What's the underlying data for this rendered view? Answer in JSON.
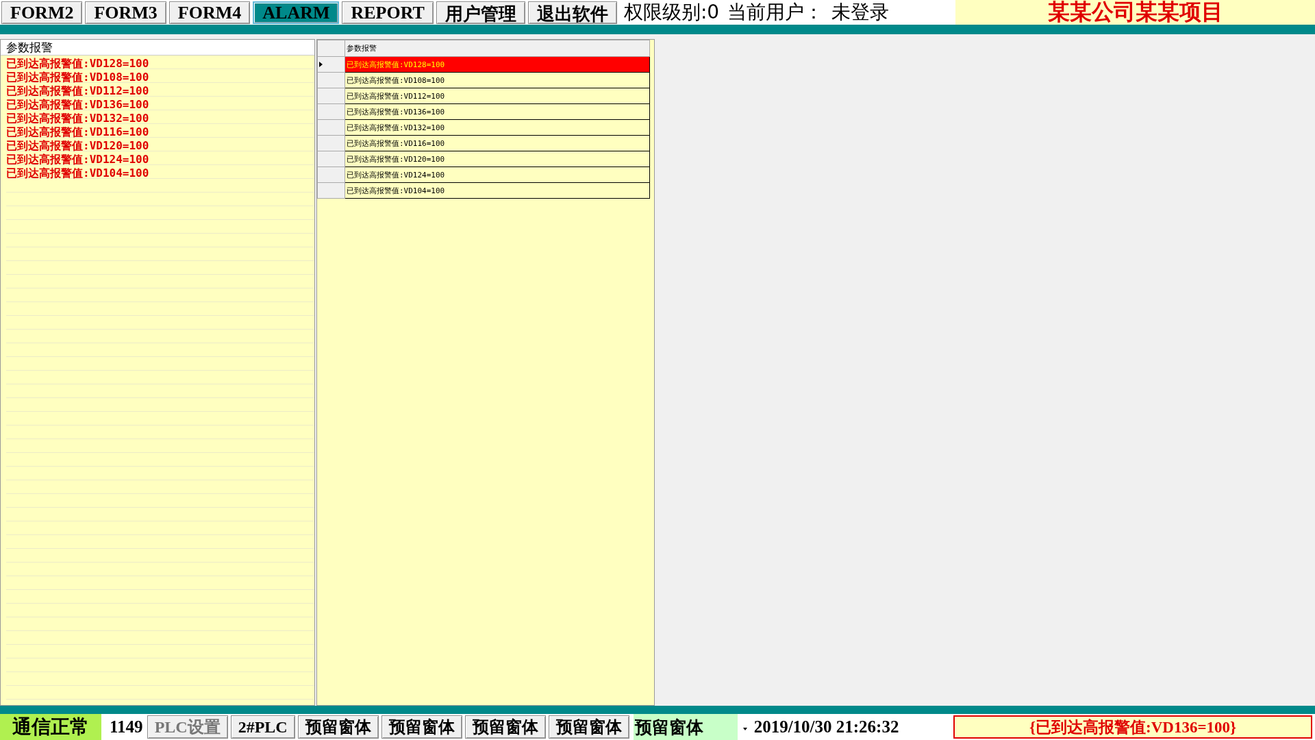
{
  "top_buttons": [
    {
      "label": "FORM2",
      "selected": false
    },
    {
      "label": "FORM3",
      "selected": false
    },
    {
      "label": "FORM4",
      "selected": false
    },
    {
      "label": "ALARM",
      "selected": true
    },
    {
      "label": "REPORT",
      "selected": false
    },
    {
      "label": "用户管理",
      "selected": false
    },
    {
      "label": "退出软件",
      "selected": false
    }
  ],
  "user_info": [
    "权限级别:0",
    "当前用户：",
    "未登录"
  ],
  "project_title": "某某公司某某项目",
  "alarm_list": {
    "header": "参数报警",
    "items": [
      "已到达高报警值:VD128=100",
      "已到达高报警值:VD108=100",
      "已到达高报警值:VD112=100",
      "已到达高报警值:VD136=100",
      "已到达高报警值:VD132=100",
      "已到达高报警值:VD116=100",
      "已到达高报警值:VD120=100",
      "已到达高报警值:VD124=100",
      "已到达高报警值:VD104=100"
    ]
  },
  "alarm_grid": {
    "column": "参数报警",
    "rows": [
      {
        "text": "已到达高报警值:VD128=100",
        "selected": true
      },
      {
        "text": "已到达高报警值:VD108=100",
        "selected": false
      },
      {
        "text": "已到达高报警值:VD112=100",
        "selected": false
      },
      {
        "text": "已到达高报警值:VD136=100",
        "selected": false
      },
      {
        "text": "已到达高报警值:VD132=100",
        "selected": false
      },
      {
        "text": "已到达高报警值:VD116=100",
        "selected": false
      },
      {
        "text": "已到达高报警值:VD120=100",
        "selected": false
      },
      {
        "text": "已到达高报警值:VD124=100",
        "selected": false
      },
      {
        "text": "已到达高报警值:VD104=100",
        "selected": false
      }
    ]
  },
  "status_bar": {
    "comm_status": "通信正常",
    "count": "1149",
    "buttons": [
      {
        "label": "PLC设置",
        "disabled": true
      },
      {
        "label": "2#PLC",
        "disabled": false
      },
      {
        "label": "预留窗体",
        "disabled": false
      },
      {
        "label": "预留窗体",
        "disabled": false
      },
      {
        "label": "预留窗体",
        "disabled": false
      },
      {
        "label": "预留窗体",
        "disabled": false
      }
    ],
    "dropdown": {
      "value": "预留窗体"
    },
    "datetime": "2019/10/30 21:26:32",
    "current_alarm": "{已到达高报警值:VD136=100}"
  }
}
